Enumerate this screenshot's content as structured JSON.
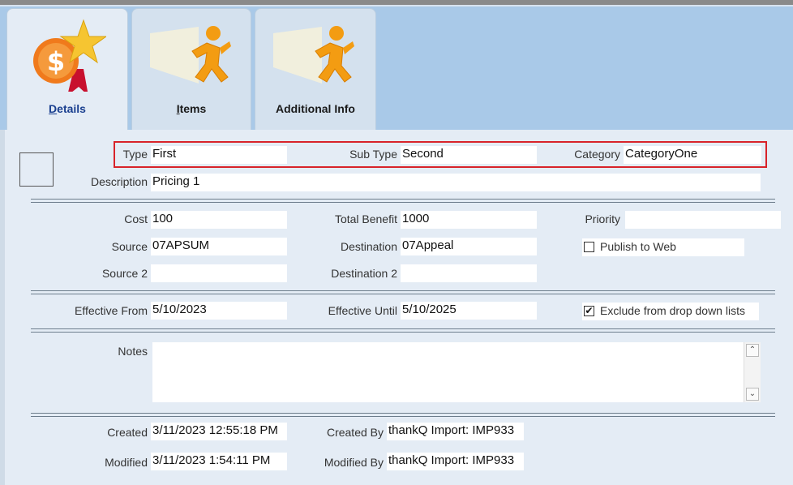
{
  "tabs": [
    {
      "label": "Details",
      "icon": "dollar-star-ribbon-icon",
      "active": true
    },
    {
      "label": "Items",
      "icon": "running-man-icon",
      "active": false
    },
    {
      "label": "Additional Info",
      "icon": "running-man-icon",
      "active": false
    }
  ],
  "fields": {
    "type_label": "Type",
    "type_value": "First",
    "subtype_label": "Sub Type",
    "subtype_value": "Second",
    "category_label": "Category",
    "category_value": "CategoryOne",
    "description_label": "Description",
    "description_value": "Pricing 1",
    "cost_label": "Cost",
    "cost_value": "100",
    "total_benefit_label": "Total Benefit",
    "total_benefit_value": "1000",
    "priority_label": "Priority",
    "priority_value": "",
    "source_label": "Source",
    "source_value": "07APSUM",
    "destination_label": "Destination",
    "destination_value": "07Appeal",
    "publish_label": "Publish to Web",
    "publish_checked": false,
    "source2_label": "Source 2",
    "source2_value": "",
    "destination2_label": "Destination 2",
    "destination2_value": "",
    "effective_from_label": "Effective From",
    "effective_from_value": "5/10/2023",
    "effective_until_label": "Effective Until",
    "effective_until_value": "5/10/2025",
    "exclude_label": "Exclude from drop down lists",
    "exclude_checked": true,
    "notes_label": "Notes",
    "notes_value": "",
    "created_label": "Created",
    "created_value": "3/11/2023 12:55:18 PM",
    "created_by_label": "Created By",
    "created_by_value": "thankQ Import: IMP933",
    "modified_label": "Modified",
    "modified_value": "3/11/2023 1:54:11 PM",
    "modified_by_label": "Modified By",
    "modified_by_value": "thankQ Import: IMP933"
  },
  "glyphs": {
    "check": "✔",
    "scroll_up": "⌃",
    "scroll_down": "⌄"
  },
  "colors": {
    "tab_bg": "#a9c9e8",
    "panel_bg": "#e4ecf5",
    "highlight": "#d8232a",
    "active_tab_text": "#1a3f8f"
  }
}
